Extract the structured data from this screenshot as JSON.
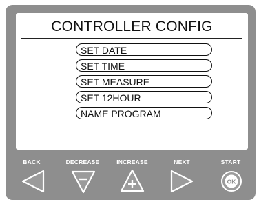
{
  "screen": {
    "title": "CONTROLLER CONFIG",
    "menu_items": [
      {
        "label": "SET DATE"
      },
      {
        "label": "SET TIME"
      },
      {
        "label": "SET MEASURE"
      },
      {
        "label": "SET 12HOUR"
      },
      {
        "label": "NAME PROGRAM"
      }
    ]
  },
  "controls": {
    "back_label": "BACK",
    "decrease_label": "DECREASE",
    "increase_label": "INCREASE",
    "next_label": "NEXT",
    "start_label": "START",
    "ok_text": "OK"
  },
  "colors": {
    "device_body": "#8e8e8e",
    "screen_bg": "#ffffff",
    "text": "#111111"
  }
}
